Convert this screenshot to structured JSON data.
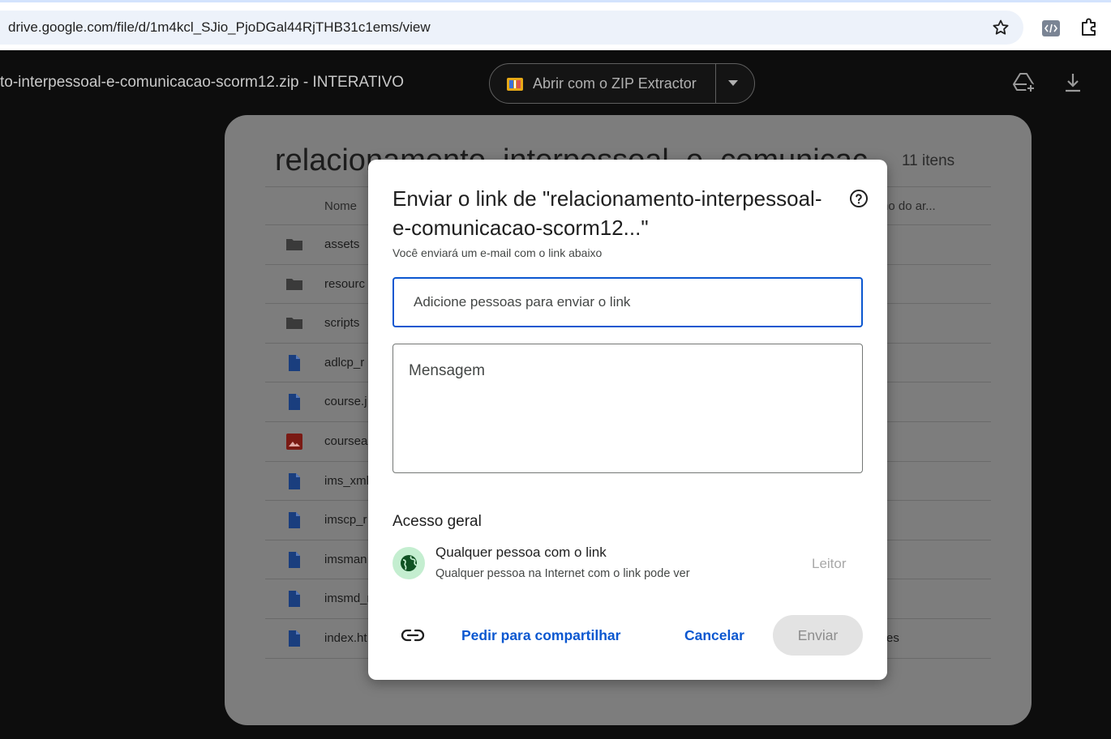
{
  "browser": {
    "url": "drive.google.com/file/d/1m4kcl_SJio_PjoDGal44RjTHB31c1ems/view",
    "icons": [
      "star-icon",
      "devtools-icon",
      "extensions-icon"
    ]
  },
  "viewer": {
    "filename": "to-interpessoal-e-comunicacao-scorm12.zip - INTERATIVO",
    "open_with_label": "Abrir com o ZIP Extractor",
    "icons": [
      "add-to-drive-icon",
      "download-icon"
    ]
  },
  "zip_preview": {
    "title": "relacionamento_interpessoal_e_comunicac",
    "count": "11 itens",
    "columns": {
      "name": "Nome",
      "size": "no do ar..."
    },
    "rows": [
      {
        "name": "assets",
        "type": "folder",
        "tail": ""
      },
      {
        "name": "resourc",
        "type": "folder",
        "tail": ""
      },
      {
        "name": "scripts",
        "type": "folder",
        "tail": ""
      },
      {
        "name": "adlcp_r",
        "type": "file",
        "tail": ""
      },
      {
        "name": "course.j",
        "type": "file",
        "tail": ""
      },
      {
        "name": "coursea",
        "type": "image",
        "tail": ""
      },
      {
        "name": "ims_xml",
        "type": "file",
        "tail": ""
      },
      {
        "name": "imscp_r",
        "type": "file",
        "tail": ""
      },
      {
        "name": "imsman",
        "type": "file",
        "tail": ""
      },
      {
        "name": "imsmd_r",
        "type": "file",
        "tail": ""
      },
      {
        "name": "index.ht",
        "type": "file",
        "tail": "es"
      }
    ]
  },
  "dialog": {
    "title": "Enviar o link de \"relacionamento-interpessoal-e-comunicacao-scorm12...\"",
    "subtitle": "Você enviará um e-mail com o link abaixo",
    "people_placeholder": "Adicione pessoas para enviar o link",
    "message_placeholder": "Mensagem",
    "access_heading": "Acesso geral",
    "access_option": "Qualquer pessoa com o link",
    "access_description": "Qualquer pessoa na Internet com o link pode ver",
    "role": "Leitor",
    "ask_share_label": "Pedir para compartilhar",
    "cancel_label": "Cancelar",
    "send_label": "Enviar",
    "accent_color": "#0b57d0",
    "globe_badge_color": "#c4eed0"
  }
}
